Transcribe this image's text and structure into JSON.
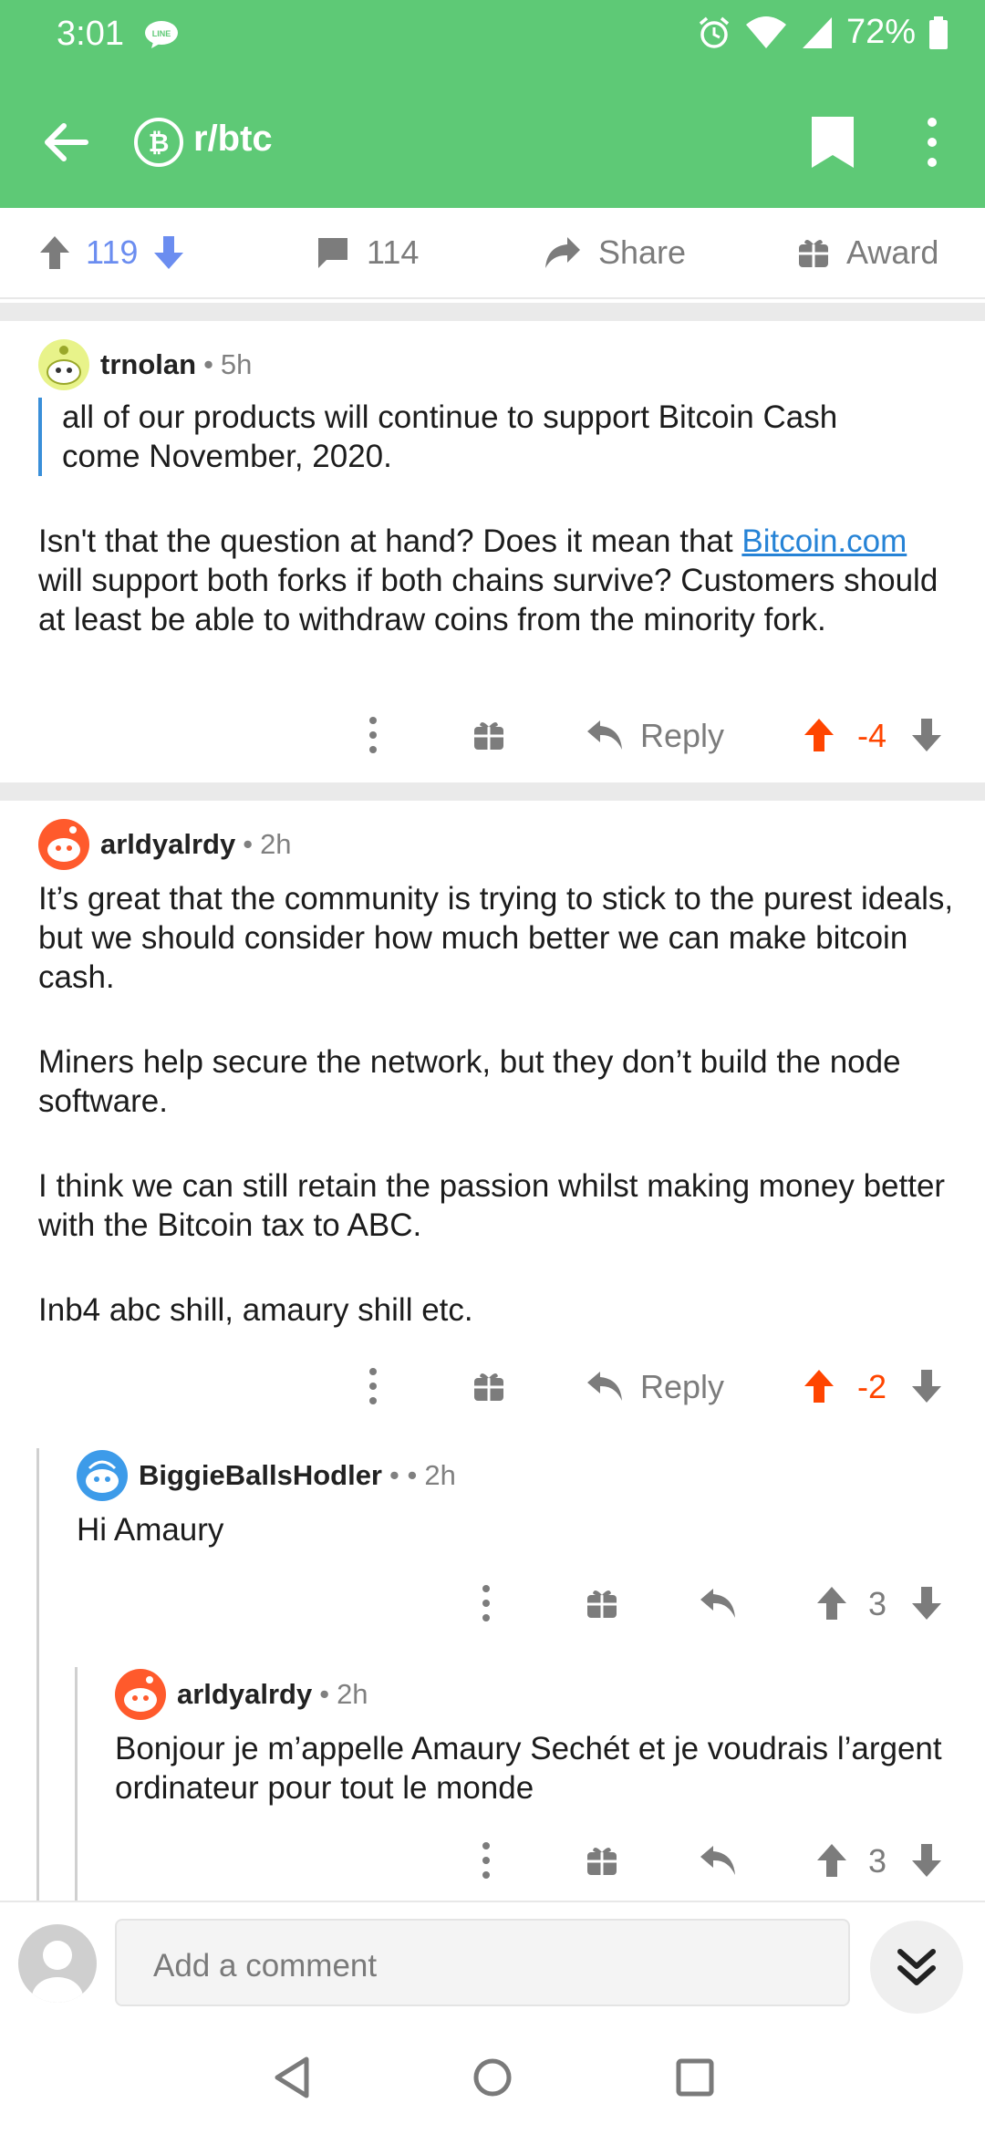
{
  "status_bar": {
    "time": "3:01",
    "line_badge": "LINE",
    "battery": "72%"
  },
  "app_bar": {
    "subreddit": "r/btc"
  },
  "post_actions": {
    "upvotes": "119",
    "comments": "114",
    "share_label": "Share",
    "award_label": "Award"
  },
  "comments": [
    {
      "author": "trnolan",
      "dot": "•",
      "time": "5h",
      "quote": "all of our products will continue to support Bitcoin Cash come November, 2020.",
      "para1_before": "Isn't that the question at hand?  Does it mean that ",
      "para1_link": "Bitcoin.com",
      "para1_after": " will support both forks if both chains survive?  Customers should at least be able to withdraw coins from the minority fork.",
      "reply_label": "Reply",
      "score": "-4"
    },
    {
      "author": "arldyalrdy",
      "dot": "•",
      "time": "2h",
      "paragraphs": [
        "It’s great that the community is trying to stick to the purest ideals, but we should consider how much better we can make bitcoin cash.",
        "Miners help secure the network, but they don’t build the node software.",
        "I think we can still retain the passion whilst making money better with the Bitcoin tax to ABC.",
        "Inb4 abc shill, amaury shill etc."
      ],
      "reply_label": "Reply",
      "score": "-2"
    },
    {
      "author": "BiggieBallsHodler",
      "dot": "• •",
      "time": "2h",
      "text": "Hi Amaury",
      "score": "3"
    },
    {
      "author": "arldyalrdy",
      "dot": "•",
      "time": "2h",
      "text": "Bonjour je m’appelle Amaury Sechét et je voudrais l’argent ordinateur pour tout le monde",
      "score": "3"
    }
  ],
  "comment_input": {
    "placeholder": "Add a comment"
  },
  "colors": {
    "brand_green": "#5ec976",
    "upvote_blue": "#6b8df0",
    "downvoted_orange": "#ff4500",
    "link_blue": "#2683d6",
    "quote_bar": "#3a8fd9"
  }
}
